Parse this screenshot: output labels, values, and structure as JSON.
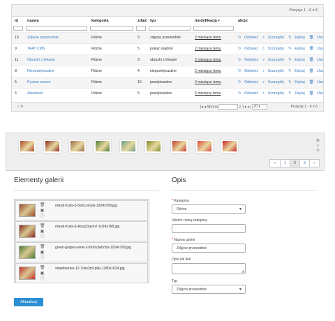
{
  "grid": {
    "position_text_top": "Pozycje 1 - 6 z 6",
    "columns": [
      "id",
      "nazwa",
      "kategoria",
      "zdjęć",
      "typ",
      "modyfikacja",
      "akcje"
    ],
    "rows": [
      {
        "id": "10",
        "nazwa": "Zdjęcie przewodnie",
        "kategoria": "Różne",
        "zdjec": "9",
        "typ": "zdjęcie przewodnie",
        "modyfikacja": "2 miesiące temu"
      },
      {
        "id": "9",
        "nazwa": "TAAT CMS",
        "kategoria": "Różne",
        "zdjec": "5",
        "typ": "pokaz slajdów",
        "modyfikacja": "2 miesiące temu"
      },
      {
        "id": "11",
        "nazwa": "Obrazki z linkami",
        "kategoria": "Różne",
        "zdjec": "3",
        "typ": "obrazki z linkami",
        "modyfikacja": "2 miesiące temu"
      },
      {
        "id": "8",
        "nazwa": "Niepowiększalne",
        "kategoria": "Różne",
        "zdjec": "4",
        "typ": "niepowiększalne",
        "modyfikacja": "2 miesiące temu"
      },
      {
        "id": "5",
        "nazwa": "Pyszne owoce",
        "kategoria": "Różne",
        "zdjec": "10",
        "typ": "powiększalne",
        "modyfikacja": "2 miesiące temu"
      },
      {
        "id": "6",
        "nazwa": "Akwarium",
        "kategoria": "Różne",
        "zdjec": "5",
        "typ": "powiększalne",
        "modyfikacja": "5 miesięcy temu"
      }
    ],
    "actions": {
      "refresh": "Odśwież",
      "details": "Szczegóły",
      "edit": "Edytuj",
      "delete": "Usuń"
    },
    "pager": {
      "page_label": "Strona",
      "of_label": "z 1",
      "page_size": "20",
      "position_text_bottom": "Pozycje 1 - 6 z 6"
    }
  },
  "gallery_strip": {
    "thumbs": [
      {
        "icon": "fruit-thumb",
        "color": "#b0462a"
      },
      {
        "icon": "fruit-thumb",
        "color": "#8e2a22"
      },
      {
        "icon": "fruit-thumb",
        "color": "#9a6a48"
      },
      {
        "icon": "grapes-thumb",
        "color": "#4d7a3a"
      },
      {
        "icon": "aquarium-thumb",
        "color": "#6a9a86"
      },
      {
        "icon": "fruit-thumb",
        "color": "#7e8a2a"
      },
      {
        "icon": "fruit-thumb",
        "color": "#c23a2e"
      },
      {
        "icon": "banner-thumb",
        "color": "#d8473a"
      },
      {
        "icon": "strawberry-thumb",
        "color": "#c8282a"
      }
    ],
    "pagination": [
      "«",
      "1",
      "2",
      "3",
      "»"
    ],
    "active_page": "2"
  },
  "elements": {
    "title": "Elementy galerii",
    "items": [
      {
        "file": "mixed-fruits-5-5vmcomulx-1024x768.jpg",
        "color": "#9a4a2a"
      },
      {
        "file": "mixed-fruits-3-4bzq31asm7-1024x768.jpg",
        "color": "#8a2a24"
      },
      {
        "file": "green-grapes-wine-2-8m0s3w0c6o-1024x768.jpg",
        "color": "#4f7a36"
      },
      {
        "file": "strawberries-12-7ubs3m1p6p-1280x1024.jpg",
        "color": "#c4302c"
      }
    ]
  },
  "opis": {
    "title": "Opis",
    "kategoria_label": "Kategoria",
    "kategoria_value": "Różne",
    "new_category_label": "Utwórz nową kategorię",
    "name_label": "Nazwa galerii",
    "name_value": "Zdjęcie przewodnie",
    "desc_label": "Opis lub link",
    "type_label": "Typ",
    "type_value": "Zdjęcie przewodnie"
  },
  "update_button": "Aktualizuj",
  "colors": {
    "accent": "#3b7fc4",
    "button": "#2a8fd4",
    "required": "#dd0000"
  }
}
